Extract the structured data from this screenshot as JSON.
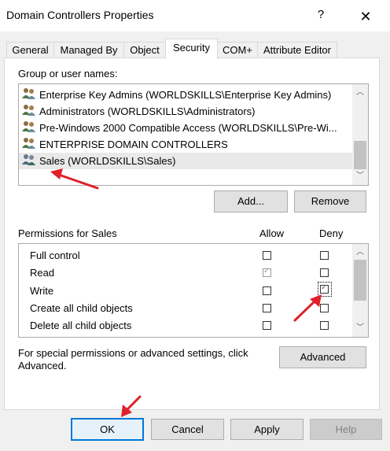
{
  "window": {
    "title": "Domain Controllers Properties",
    "help_glyph": "?",
    "close_glyph": "✕"
  },
  "tabs": [
    {
      "label": "General"
    },
    {
      "label": "Managed By"
    },
    {
      "label": "Object"
    },
    {
      "label": "Security",
      "active": true
    },
    {
      "label": "COM+"
    },
    {
      "label": "Attribute Editor"
    }
  ],
  "security": {
    "group_label": "Group or user names:",
    "principals": [
      {
        "name": "Enterprise Key Admins (WORLDSKILLS\\Enterprise Key Admins)",
        "icon": "user-group-icon"
      },
      {
        "name": "Administrators (WORLDSKILLS\\Administrators)",
        "icon": "user-group-icon"
      },
      {
        "name": "Pre-Windows 2000 Compatible Access (WORLDSKILLS\\Pre-Wi...",
        "icon": "user-group-icon"
      },
      {
        "name": "ENTERPRISE DOMAIN CONTROLLERS",
        "icon": "user-group-icon"
      },
      {
        "name": "Sales (WORLDSKILLS\\Sales)",
        "icon": "user-group-icon",
        "selected": true
      }
    ],
    "add_label": "Add...",
    "remove_label": "Remove",
    "permissions_for": "Permissions for Sales",
    "allow_header": "Allow",
    "deny_header": "Deny",
    "permissions": [
      {
        "name": "Full control",
        "allow": false,
        "deny": false
      },
      {
        "name": "Read",
        "allow": true,
        "allow_inherited": true,
        "deny": false
      },
      {
        "name": "Write",
        "allow": false,
        "deny": true
      },
      {
        "name": "Create all child objects",
        "allow": false,
        "deny": false
      },
      {
        "name": "Delete all child objects",
        "allow": false,
        "deny": false
      }
    ],
    "advanced_text": "For special permissions or advanced settings, click Advanced.",
    "advanced_label": "Advanced"
  },
  "footer": {
    "ok_label": "OK",
    "cancel_label": "Cancel",
    "apply_label": "Apply",
    "help_label": "Help"
  },
  "colors": {
    "annotation_arrow": "#e0202a",
    "focus": "#0078d7"
  }
}
